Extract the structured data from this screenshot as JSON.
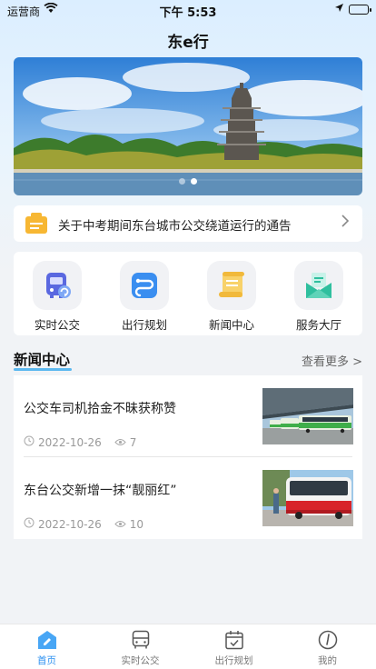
{
  "status_bar": {
    "carrier": "运营商",
    "time": "下午 5:53"
  },
  "app": {
    "title": "东e行"
  },
  "banner": {
    "slides": 2,
    "active_slide": 2
  },
  "notice": {
    "text": "关于中考期间东台城市公交绕道运行的通告"
  },
  "quick_menu": {
    "items": [
      {
        "label": "实时公交",
        "icon": "bus-refresh-icon"
      },
      {
        "label": "出行规划",
        "icon": "route-plan-icon"
      },
      {
        "label": "新闻中心",
        "icon": "news-scroll-icon"
      },
      {
        "label": "服务大厅",
        "icon": "service-mail-icon"
      }
    ]
  },
  "news": {
    "title": "新闻中心",
    "more": "查看更多 >",
    "items": [
      {
        "title": "公交车司机拾金不昧获称赞",
        "date": "2022-10-26",
        "views": "7"
      },
      {
        "title": "东台公交新增一抹“靓丽红”",
        "date": "2022-10-26",
        "views": "10"
      }
    ]
  },
  "tab_bar": {
    "items": [
      {
        "label": "首页",
        "active": true
      },
      {
        "label": "实时公交",
        "active": false
      },
      {
        "label": "出行规划",
        "active": false
      },
      {
        "label": "我的",
        "active": false
      }
    ]
  },
  "colors": {
    "accent": "#2a8ff0",
    "underline": "#5cb8f0"
  }
}
